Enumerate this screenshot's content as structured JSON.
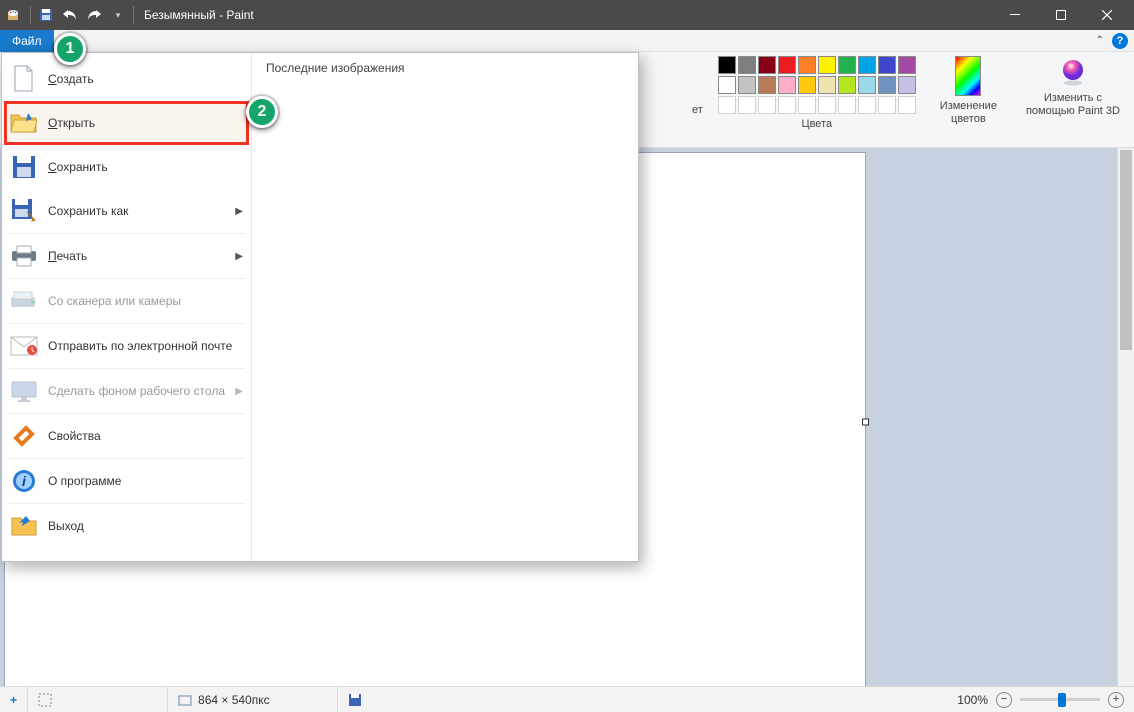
{
  "window": {
    "title": "Безымянный - Paint"
  },
  "tabs": {
    "file": "Файл"
  },
  "ribbon": {
    "cut_label_2": "ет",
    "colors_group_label": "Цвета",
    "edit_colors_label": "Изменение\nцветов",
    "paint3d_label": "Изменить с\nпомощью Paint 3D",
    "palette_row1": [
      "#000000",
      "#7f7f7f",
      "#880015",
      "#ed1c24",
      "#ff7f27",
      "#fff200",
      "#22b14c",
      "#00a2e8",
      "#3f48cc",
      "#a349a4"
    ],
    "palette_row2": [
      "#ffffff",
      "#c3c3c3",
      "#b97a57",
      "#ffaec9",
      "#ffc90e",
      "#efe4b0",
      "#b5e61d",
      "#99d9ea",
      "#7092be",
      "#c8bfe7"
    ]
  },
  "file_menu": {
    "recent_header": "Последние изображения",
    "items": {
      "new": "Создать",
      "open": "Открыть",
      "save": "Сохранить",
      "saveas": "Сохранить как",
      "print": "Печать",
      "scanner": "Со сканера или камеры",
      "email": "Отправить по электронной почте",
      "wall": "Сделать фоном рабочего стола",
      "props": "Свойства",
      "about": "О программе",
      "exit": "Выход"
    }
  },
  "status": {
    "cursor_icon": "+",
    "canvas_size": "864 × 540пкс",
    "zoom": "100%"
  },
  "annotations": {
    "one": "1",
    "two": "2"
  }
}
